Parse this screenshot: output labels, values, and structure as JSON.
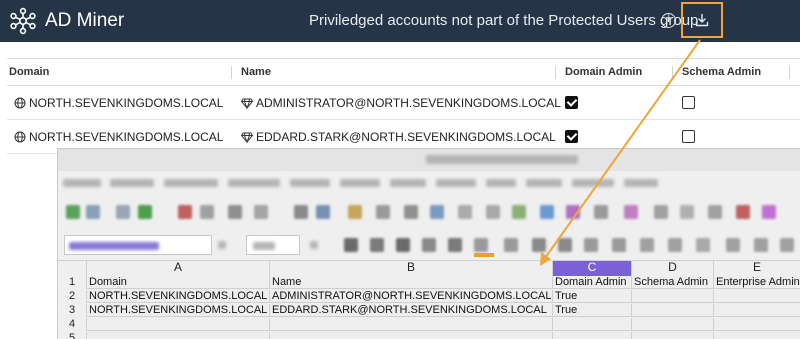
{
  "app": {
    "name": "AD Miner",
    "page_title": "Priviledged accounts not part of the Protected Users group",
    "info_icon": "info-icon",
    "download_icon": "download-icon",
    "highlight_color": "#f0a53c",
    "topbar_color": "#253447"
  },
  "table": {
    "columns": [
      "Domain",
      "Name",
      "Domain Admin",
      "Schema Admin"
    ],
    "rows": [
      {
        "domain": "NORTH.SEVENKINGDOMS.LOCAL",
        "name": "ADMINISTRATOR@NORTH.SEVENKINGDOMS.LOCAL",
        "domain_admin": true,
        "schema_admin": false
      },
      {
        "domain": "NORTH.SEVENKINGDOMS.LOCAL",
        "name": "EDDARD.STARK@NORTH.SEVENKINGDOMS.LOCAL",
        "domain_admin": true,
        "schema_admin": false
      }
    ]
  },
  "spreadsheet": {
    "column_letters": [
      "A",
      "B",
      "C",
      "D",
      "E"
    ],
    "selected_column": "C",
    "selected_color": "#7b61d8",
    "row_numbers": [
      "1",
      "2",
      "3",
      "4",
      "5"
    ],
    "headers": [
      "Domain",
      "Name",
      "Domain Admin",
      "Schema Admin",
      "Enterprise Admin"
    ],
    "rows": [
      [
        "NORTH.SEVENKINGDOMS.LOCAL",
        "ADMINISTRATOR@NORTH.SEVENKINGDOMS.LOCAL",
        "True",
        "",
        ""
      ],
      [
        "NORTH.SEVENKINGDOMS.LOCAL",
        "EDDARD.STARK@NORTH.SEVENKINGDOMS.LOCAL",
        "True",
        "",
        ""
      ]
    ]
  }
}
